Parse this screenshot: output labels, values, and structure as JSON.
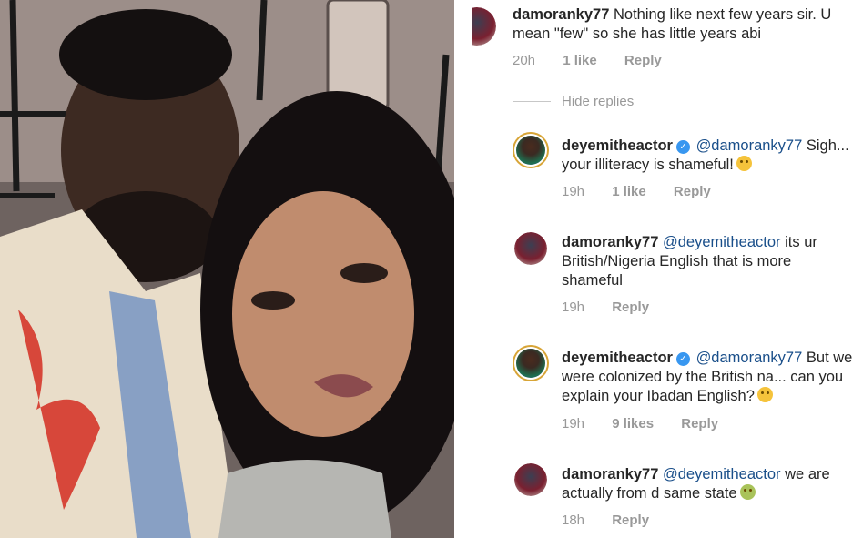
{
  "comments": [
    {
      "username": "damoranky77",
      "text": "Nothing like next few years sir. U mean \"few\" so she has little years abi",
      "time": "20h",
      "likes": "1 like",
      "reply": "Reply"
    }
  ],
  "hide_replies": "Hide replies",
  "replies": [
    {
      "username": "deyemitheactor",
      "verified": true,
      "mention": "@damoranky77",
      "text": "Sigh... your illiteracy is shameful!",
      "time": "19h",
      "likes": "1 like",
      "reply": "Reply"
    },
    {
      "username": "damoranky77",
      "mention": "@deyemitheactor",
      "text": "its ur British/Nigeria English that is more shameful",
      "time": "19h",
      "reply": "Reply"
    },
    {
      "username": "deyemitheactor",
      "verified": true,
      "mention": "@damoranky77",
      "text": "But we were colonized by the British na... can you explain your Ibadan English?",
      "time": "19h",
      "likes": "9 likes",
      "reply": "Reply"
    },
    {
      "username": "damoranky77",
      "mention": "@deyemitheactor",
      "text": "we are actually from d same state",
      "time": "18h",
      "reply": "Reply"
    }
  ],
  "icons": {
    "verified": "verified-badge-icon",
    "emoji_1": "unamused-face-emoji",
    "emoji_2": "grinning-sweat-emoji",
    "emoji_3": "nauseated-face-emoji"
  },
  "colors": {
    "username": "#262626",
    "mention": "#1a4f8a",
    "meta": "#999999",
    "verified": "#3897f0",
    "story_ring": "#d8a537"
  }
}
